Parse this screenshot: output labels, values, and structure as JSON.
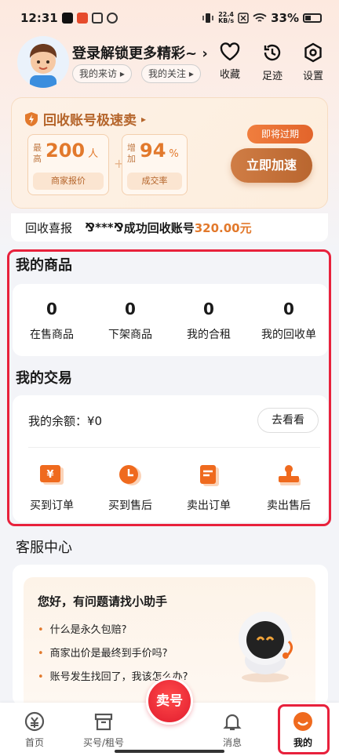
{
  "status_bar": {
    "time": "12:31",
    "net_speed_top": "22.4",
    "net_speed_unit": "KB/s",
    "battery": "33%"
  },
  "header": {
    "login_title": "登录解锁更多精彩~",
    "chips": [
      "我的来访",
      "我的关注"
    ],
    "actions": [
      {
        "label": "收藏",
        "icon": "heart-icon"
      },
      {
        "label": "足迹",
        "icon": "history-icon"
      },
      {
        "label": "设置",
        "icon": "settings-icon"
      }
    ]
  },
  "recycle": {
    "title": "回收账号极速卖",
    "quote": {
      "side_label": "最高",
      "value": "200",
      "unit": "人",
      "footer": "商家报价"
    },
    "rate": {
      "side_label": "增加",
      "value": "94",
      "unit": "%",
      "footer": "成交率"
    },
    "tag": "即将过期",
    "button": "立即加速"
  },
  "ticker": {
    "label": "回收喜报",
    "user": "⅋***⅋",
    "text": "成功回收账号",
    "amount": "320.00元"
  },
  "goods": {
    "title": "我的商品",
    "items": [
      {
        "count": "0",
        "label": "在售商品"
      },
      {
        "count": "0",
        "label": "下架商品"
      },
      {
        "count": "0",
        "label": "我的合租"
      },
      {
        "count": "0",
        "label": "我的回收单"
      }
    ]
  },
  "trade": {
    "title": "我的交易",
    "balance": "我的余额：¥0",
    "view_button": "去看看",
    "items": [
      {
        "label": "买到订单",
        "icon": "yuan-icon"
      },
      {
        "label": "买到售后",
        "icon": "clock-icon"
      },
      {
        "label": "卖出订单",
        "icon": "document-icon"
      },
      {
        "label": "卖出售后",
        "icon": "stamp-icon"
      }
    ]
  },
  "service": {
    "title": "客服中心",
    "helper_title": "您好，有问题请找小助手",
    "faqs": [
      "什么是永久包赔?",
      "商家出价是最终到手价吗?",
      "账号发生找回了，我该怎么办?"
    ]
  },
  "nav": {
    "items": [
      {
        "label": "首页",
        "icon": "home-icon"
      },
      {
        "label": "买号/租号",
        "icon": "box-icon"
      },
      {
        "label": "卖号",
        "icon": "sell-icon"
      },
      {
        "label": "消息",
        "icon": "bell-icon"
      },
      {
        "label": "我的",
        "icon": "profile-icon"
      }
    ]
  },
  "colors": {
    "accent": "#e2792c",
    "highlight_frame": "#e8213c",
    "sell": "#e11c2e"
  }
}
